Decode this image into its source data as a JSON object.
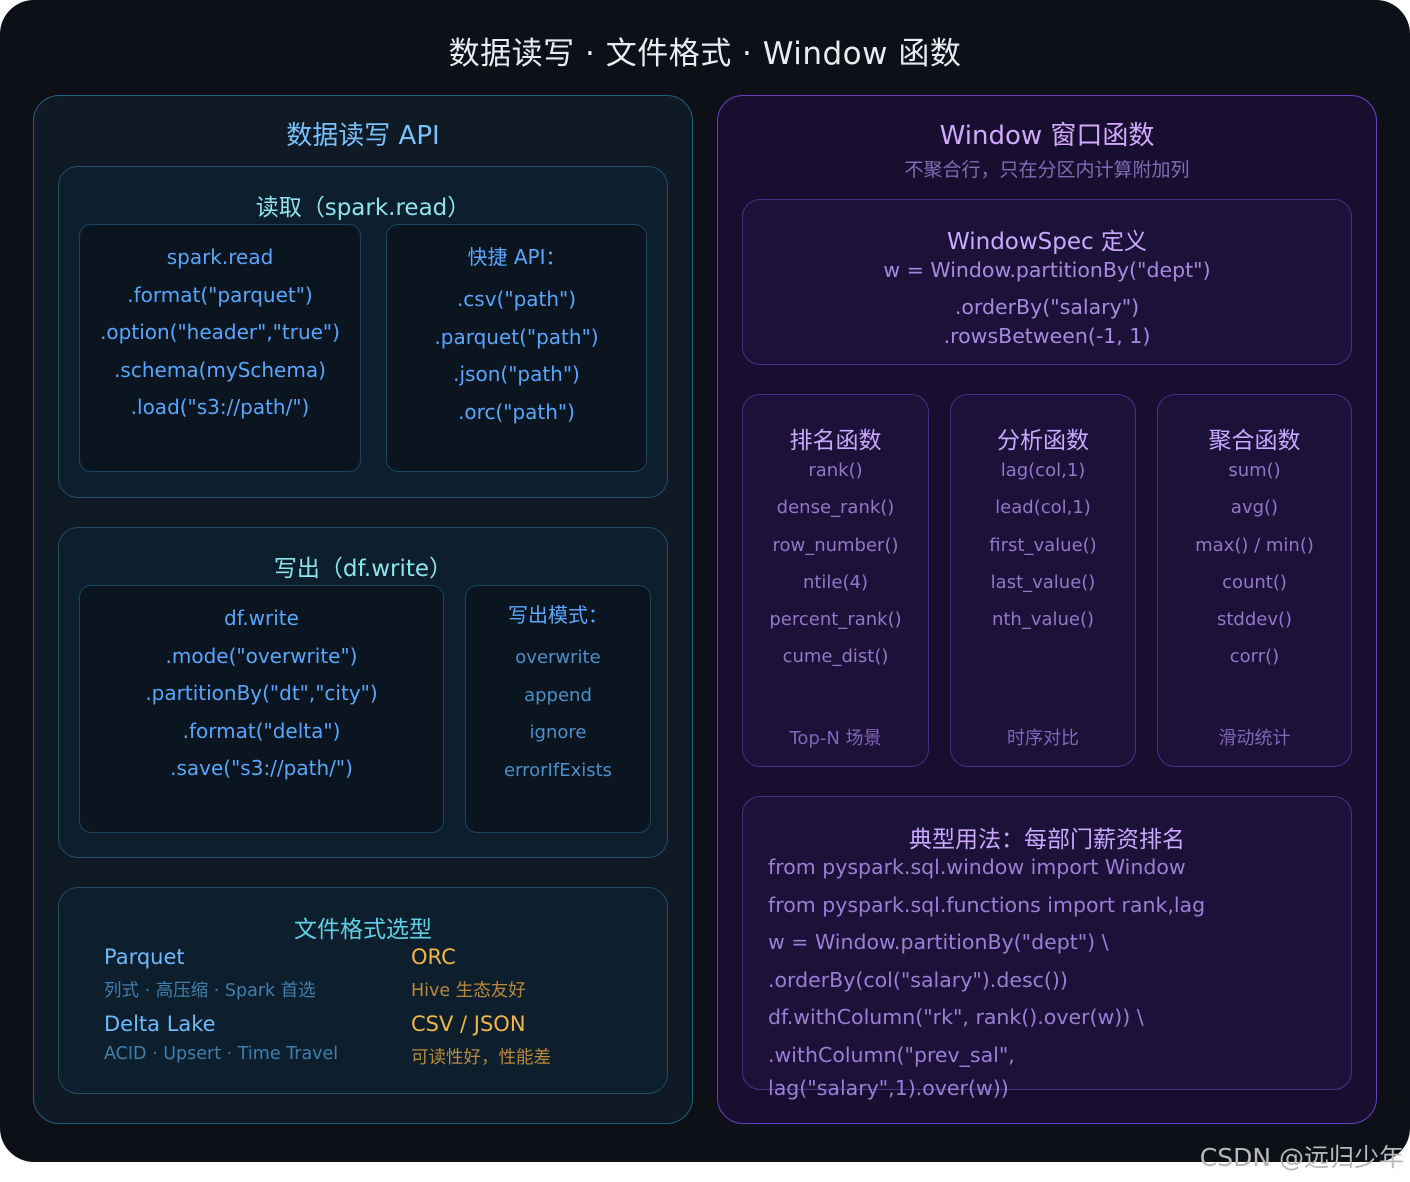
{
  "title": "数据读写 · 文件格式 · Window 函数",
  "left": {
    "heading": "数据读写 API",
    "read": {
      "title": "读取（spark.read）",
      "code": [
        "spark.read",
        ".format(\"parquet\")",
        ".option(\"header\",\"true\")",
        ".schema(mySchema)",
        ".load(\"s3://path/\")"
      ],
      "shortcut_title": "快捷 API：",
      "shortcuts": [
        ".csv(\"path\")",
        ".parquet(\"path\")",
        ".json(\"path\")",
        ".orc(\"path\")"
      ]
    },
    "write": {
      "title": "写出（df.write）",
      "code": [
        "df.write",
        ".mode(\"overwrite\")",
        ".partitionBy(\"dt\",\"city\")",
        ".format(\"delta\")",
        ".save(\"s3://path/\")"
      ],
      "modes_title": "写出模式：",
      "modes": [
        "overwrite",
        "append",
        "ignore",
        "errorIfExists"
      ]
    },
    "formats": {
      "title": "文件格式选型",
      "items": [
        {
          "name": "Parquet",
          "desc": "列式 · 高压缩 · Spark 首选"
        },
        {
          "name": "ORC",
          "desc": "Hive 生态友好"
        },
        {
          "name": "Delta Lake",
          "desc": "ACID · Upsert · Time Travel"
        },
        {
          "name": "CSV / JSON",
          "desc": "可读性好，性能差"
        }
      ]
    }
  },
  "right": {
    "heading": "Window 窗口函数",
    "subheading": "不聚合行，只在分区内计算附加列",
    "spec": {
      "title": "WindowSpec 定义",
      "code": [
        "w = Window.partitionBy(\"dept\")",
        ".orderBy(\"salary\")",
        ".rowsBetween(-1, 1)"
      ]
    },
    "groups": [
      {
        "title": "排名函数",
        "items": [
          "rank()",
          "dense_rank()",
          "row_number()",
          "ntile(4)",
          "percent_rank()",
          "cume_dist()"
        ],
        "footer": "Top-N 场景"
      },
      {
        "title": "分析函数",
        "items": [
          "lag(col,1)",
          "lead(col,1)",
          "first_value()",
          "last_value()",
          "nth_value()"
        ],
        "footer": "时序对比"
      },
      {
        "title": "聚合函数",
        "items": [
          "sum()",
          "avg()",
          "max() / min()",
          "count()",
          "stddev()",
          "corr()"
        ],
        "footer": "滑动统计"
      }
    ],
    "example": {
      "title": "典型用法：每部门薪资排名",
      "code": [
        "from pyspark.sql.window import Window",
        "from pyspark.sql.functions import rank,lag",
        "w = Window.partitionBy(\"dept\") \\",
        ".orderBy(col(\"salary\").desc())",
        "df.withColumn(\"rk\", rank().over(w)) \\",
        ".withColumn(\"prev_sal\",",
        "lag(\"salary\",1).over(w))"
      ]
    }
  },
  "watermark": "CSDN @远归少年"
}
